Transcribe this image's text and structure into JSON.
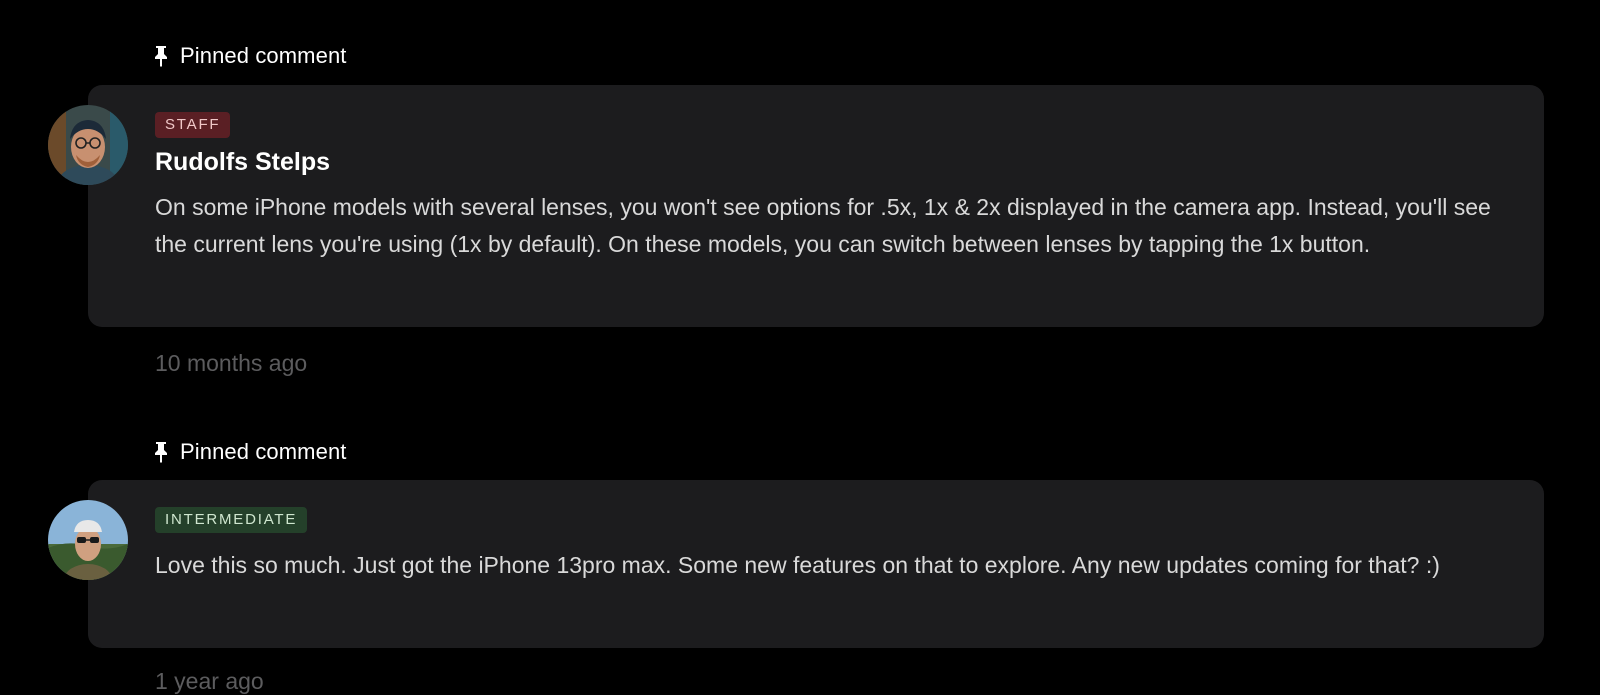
{
  "comments": [
    {
      "pinned_label": "Pinned comment",
      "badge": "STAFF",
      "author": "Rudolfs Stelps",
      "body": "On some iPhone models with several lenses, you won't see options for .5x, 1x & 2x displayed in the camera app. Instead, you'll see the current lens you're using (1x by default). On these models, you can switch between lenses by tapping the 1x button.",
      "timestamp": "10 months ago",
      "badge_color": "#5a1f24",
      "avatar_icon": "user-avatar"
    },
    {
      "pinned_label": "Pinned comment",
      "badge": "INTERMEDIATE",
      "body": "Love this so much. Just got the iPhone 13pro max. Some new features on that to explore. Any new updates coming for that? :)",
      "timestamp": "1 year ago",
      "badge_color": "#24402a",
      "avatar_icon": "user-avatar"
    }
  ],
  "colors": {
    "background": "#000000",
    "card": "#1c1c1e",
    "timestamp": "#5c5c5e"
  }
}
